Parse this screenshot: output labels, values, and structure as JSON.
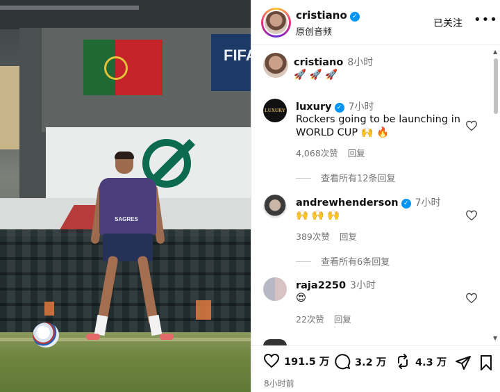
{
  "header": {
    "username": "cristiano",
    "subtitle": "原创音频",
    "follow_label": "已关注",
    "more_label": "•••"
  },
  "caption": {
    "username": "cristiano",
    "time": "8小时",
    "text": "🚀 🚀 🚀"
  },
  "comments": [
    {
      "username": "luxury",
      "verified": true,
      "time": "7小时",
      "text_line1": "Rockers going to be launching in",
      "text_line2": "WORLD CUP 🙌 🔥",
      "likes": "4,068次赞",
      "reply_label": "回复",
      "view_replies": "查看所有12条回复",
      "avatar_text": "LUXURY"
    },
    {
      "username": "andrewhenderson",
      "verified": true,
      "time": "7小时",
      "text_line1": "🙌 🙌 🙌",
      "likes": "389次赞",
      "reply_label": "回复",
      "view_replies": "查看所有6条回复"
    },
    {
      "username": "raja2250",
      "verified": false,
      "time": "3小时",
      "text_line1": "😍",
      "likes": "22次赞",
      "reply_label": "回复"
    }
  ],
  "actions": {
    "likes": "191.5 万",
    "comments": "3.2 万",
    "reposts": "4.3 万"
  },
  "post_time": "8小时前",
  "media": {
    "shirt_text": "SAGRES",
    "board_text": "FIFA"
  },
  "icons": {
    "verified": "verified-badge-icon",
    "like": "heart-icon",
    "comment": "comment-bubble-icon",
    "repost": "repost-icon",
    "share": "paper-plane-icon",
    "save": "bookmark-icon"
  },
  "colors": {
    "verified": "#0095f6",
    "muted": "#737373"
  }
}
